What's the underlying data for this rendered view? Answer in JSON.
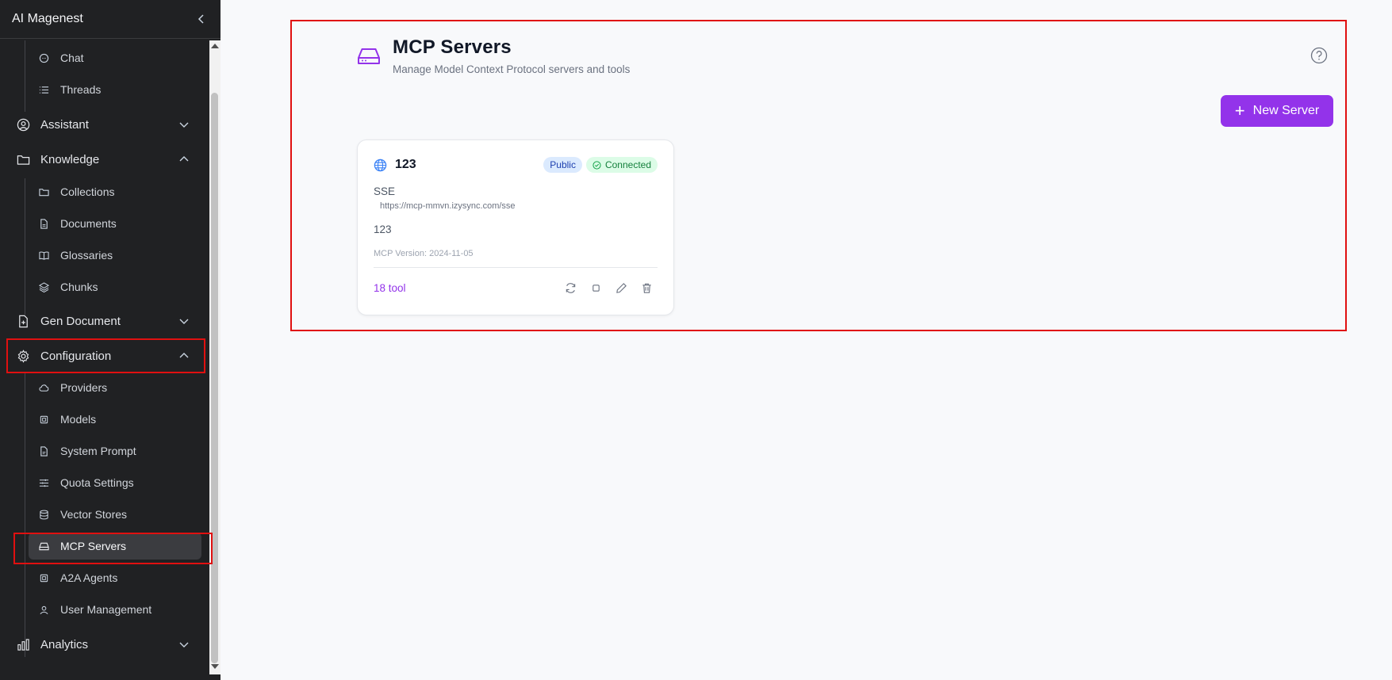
{
  "sidebar": {
    "brand": "AI Magenest",
    "groups": {
      "chat": "Chat",
      "threads": "Threads",
      "assistant": "Assistant",
      "knowledge": "Knowledge",
      "collections": "Collections",
      "documents": "Documents",
      "glossaries": "Glossaries",
      "chunks": "Chunks",
      "gen_document": "Gen Document",
      "configuration": "Configuration",
      "providers": "Providers",
      "models": "Models",
      "system_prompt": "System Prompt",
      "quota_settings": "Quota Settings",
      "vector_stores": "Vector Stores",
      "mcp_servers": "MCP Servers",
      "a2a_agents": "A2A Agents",
      "user_management": "User Management",
      "analytics": "Analytics"
    }
  },
  "main": {
    "title": "MCP Servers",
    "subtitle": "Manage Model Context Protocol servers and tools",
    "new_button": "New Server",
    "plus": "+",
    "card": {
      "name": "123",
      "badge_public": "Public",
      "badge_status": "Connected",
      "type": "SSE",
      "url": "https://mcp-mmvn.izysync.com/sse",
      "description": "123",
      "version": "MCP Version: 2024-11-05",
      "tools": "18 tool"
    }
  },
  "colors": {
    "accent": "#9333ea",
    "sidebar_bg": "#202123",
    "highlight": "#e01010"
  }
}
